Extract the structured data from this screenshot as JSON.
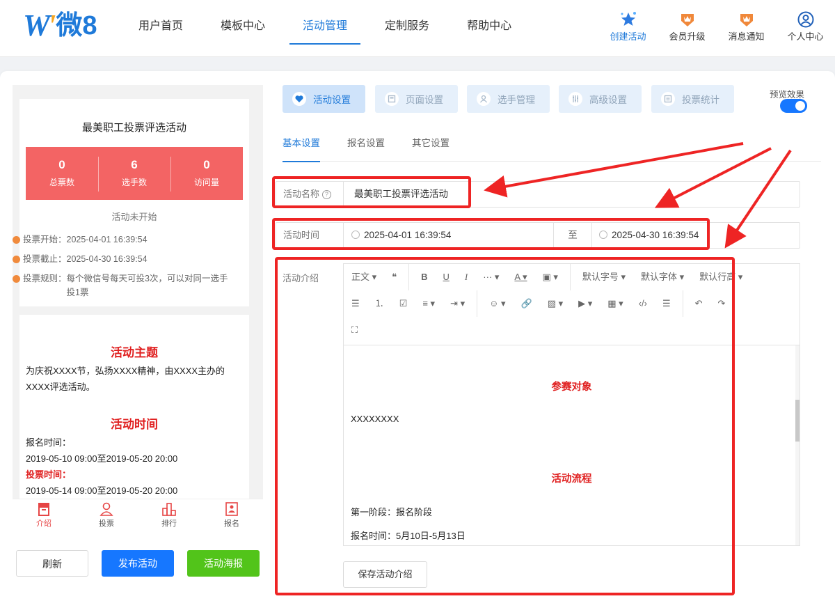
{
  "brand": {
    "logo_text": "微8"
  },
  "nav": [
    "用户首页",
    "模板中心",
    "活动管理",
    "定制服务",
    "帮助中心"
  ],
  "tools": [
    {
      "label": "创建活动",
      "icon": "star-sparkle-icon"
    },
    {
      "label": "会员升级",
      "icon": "crown-badge-icon"
    },
    {
      "label": "消息通知",
      "icon": "crown-badge-icon"
    },
    {
      "label": "个人中心",
      "icon": "user-circle-icon"
    }
  ],
  "preview": {
    "title": "最美职工投票评选活动",
    "stats": [
      {
        "value": "0",
        "label": "总票数"
      },
      {
        "value": "6",
        "label": "选手数"
      },
      {
        "value": "0",
        "label": "访问量"
      }
    ],
    "status": "活动未开始",
    "info": [
      {
        "key": "投票开始：",
        "value": "2025-04-01 16:39:54"
      },
      {
        "key": "投票截止：",
        "value": "2025-04-30 16:39:54"
      },
      {
        "key": "投票规则：",
        "value": "每个微信号每天可投3次，可以对同一选手投1票"
      }
    ],
    "theme_heading": "活动主题",
    "theme_text": "为庆祝XXXX节，弘扬XXXX精神，由XXXX主办的XXXX评选活动。",
    "time_heading": "活动时间",
    "signup_label": "报名时间：",
    "signup_range": "2019-05-10 09:00至2019-05-20 20:00",
    "vote_label": "投票时间：",
    "vote_range": "2019-05-14 09:00至2019-05-20 20:00",
    "tabs": [
      "介绍",
      "投票",
      "排行",
      "报名"
    ]
  },
  "actions": {
    "refresh": "刷新",
    "publish": "发布活动",
    "poster": "活动海报"
  },
  "steps": [
    "活动设置",
    "页面设置",
    "选手管理",
    "高级设置",
    "投票统计"
  ],
  "preview_toggle": {
    "label": "预览效果",
    "on": true
  },
  "subtabs": [
    "基本设置",
    "报名设置",
    "其它设置"
  ],
  "form": {
    "name_label": "活动名称",
    "name_value": "最美职工投票评选活动",
    "time_label": "活动时间",
    "start_time": "2025-04-01 16:39:54",
    "to": "至",
    "end_time": "2025-04-30 16:39:54",
    "intro_label": "活动介绍"
  },
  "toolbar": {
    "row1": [
      "正文 ▾",
      "❝",
      "B",
      "U",
      "I",
      "··· ▾",
      "A ▾",
      "▣ ▾",
      "默认字号 ▾",
      "默认字体 ▾",
      "默认行高 ▾"
    ],
    "row2": [
      "☰",
      "⒈",
      "☑",
      "≡ ▾",
      "⇥ ▾",
      "☺ ▾",
      "🔗",
      "▨ ▾",
      "▶ ▾",
      "▦ ▾",
      "‹/›",
      "☰",
      "↶",
      "↷"
    ],
    "row3": [
      "⛶"
    ]
  },
  "editor": {
    "h1": "参赛对象",
    "p1": "XXXXXXXX",
    "h2": "活动流程",
    "p2": "第一阶段：报名阶段",
    "p3": "报名时间：5月10日-5月13日"
  },
  "save_intro": "保存活动介绍",
  "colors": {
    "primary": "#1f7ad9",
    "stats_bg": "#f36464",
    "annotation": "#ee2424",
    "publish": "#1677ff",
    "poster": "#52c41a"
  }
}
